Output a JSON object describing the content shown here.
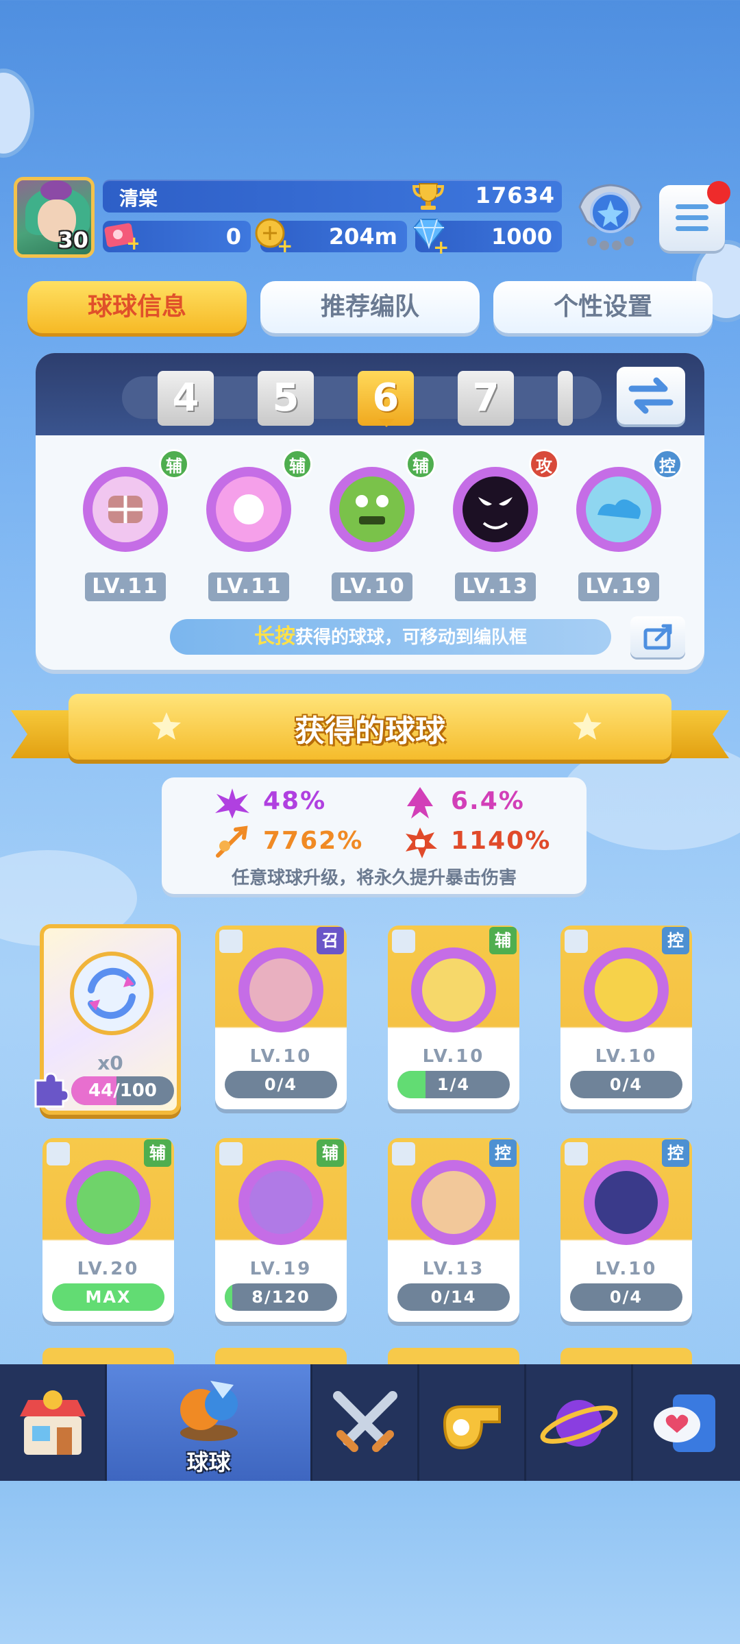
{
  "player": {
    "name": "清棠",
    "level": "30",
    "trophies": "17634",
    "tickets": "0",
    "coins": "204m",
    "gems": "1000"
  },
  "tabs": [
    {
      "label": "球球信息",
      "active": true
    },
    {
      "label": "推荐编队",
      "active": false
    },
    {
      "label": "个性设置",
      "active": false
    }
  ],
  "team": {
    "slots": [
      "4",
      "5",
      "6",
      "7"
    ],
    "active_slot": "6",
    "balls": [
      {
        "level": "LV.11",
        "role": "辅",
        "icon": "cookie-ball-icon"
      },
      {
        "level": "LV.11",
        "role": "辅",
        "icon": "light-ball-icon"
      },
      {
        "level": "LV.10",
        "role": "辅",
        "icon": "goblin-ball-icon"
      },
      {
        "level": "LV.13",
        "role": "攻",
        "icon": "venom-ball-icon"
      },
      {
        "level": "LV.19",
        "role": "控",
        "icon": "cloud-ball-icon"
      }
    ],
    "hint_highlight": "长按",
    "hint_rest": "获得的球球，可移动到编队框"
  },
  "banner": {
    "title": "获得的球球"
  },
  "stats": {
    "items": [
      {
        "value": "48%",
        "icon": "crit-rate-icon",
        "color": "#b040e0"
      },
      {
        "value": "6.4%",
        "icon": "crit-arrow-icon",
        "color": "#d23fb8"
      },
      {
        "value": "7762%",
        "icon": "sword-burst-icon",
        "color": "#f08a24"
      },
      {
        "value": "1140%",
        "icon": "fist-burst-icon",
        "color": "#e04a2a"
      }
    ],
    "note": "任意球球升级，将永久提升暴击伤害"
  },
  "special": {
    "count": "x0",
    "progress": "44/100",
    "progress_value": 0.44
  },
  "balls": [
    {
      "level": "LV.10",
      "progress": "0/4",
      "fill": 0,
      "role": "召",
      "role_class": "zhao",
      "icon": "mouth-ball-icon"
    },
    {
      "level": "LV.10",
      "progress": "1/4",
      "fill": 0.25,
      "role": "辅",
      "role_class": "fu",
      "icon": "flower-ball-icon"
    },
    {
      "level": "LV.10",
      "progress": "0/4",
      "fill": 0,
      "role": "控",
      "role_class": "kong",
      "icon": "snail-ball-icon"
    },
    {
      "level": "LV.20",
      "progress": "MAX",
      "fill": 1,
      "role": "辅",
      "role_class": "fu",
      "icon": "star-arrow-ball-icon"
    },
    {
      "level": "LV.19",
      "progress": "8/120",
      "fill": 0.07,
      "role": "辅",
      "role_class": "fu",
      "icon": "sprout-ball-icon"
    },
    {
      "level": "LV.13",
      "progress": "0/14",
      "fill": 0,
      "role": "控",
      "role_class": "kong",
      "icon": "monkey-ball-icon"
    },
    {
      "level": "LV.10",
      "progress": "0/4",
      "fill": 0,
      "role": "控",
      "role_class": "kong",
      "icon": "ninja-ball-icon"
    }
  ],
  "nav": [
    {
      "name": "shop",
      "label": "",
      "icon": "shop-icon",
      "active": false
    },
    {
      "name": "balls",
      "label": "球球",
      "icon": "balls-icon",
      "active": true
    },
    {
      "name": "battle",
      "label": "",
      "icon": "crossed-swords-icon",
      "active": false
    },
    {
      "name": "whistle",
      "label": "",
      "icon": "whistle-icon",
      "active": false
    },
    {
      "name": "planet",
      "label": "",
      "icon": "planet-icon",
      "active": false
    },
    {
      "name": "social",
      "label": "",
      "icon": "chat-heart-icon",
      "active": false
    }
  ]
}
